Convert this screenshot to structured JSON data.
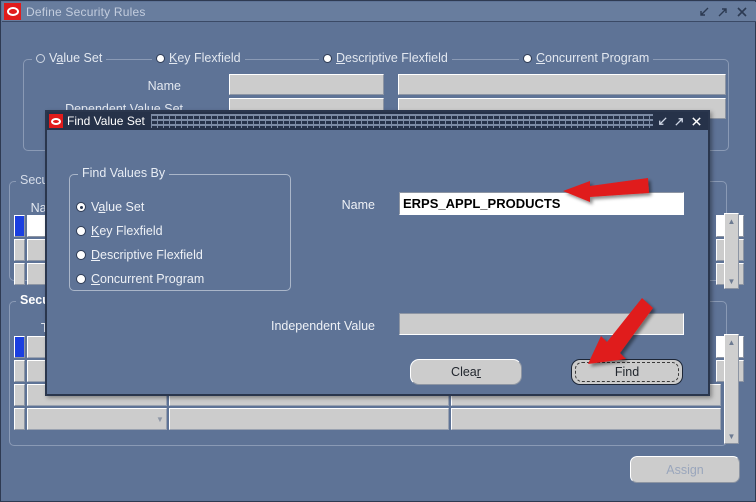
{
  "main_window": {
    "title": "Define Security Rules",
    "logo": "oracle-logo",
    "window_controls": [
      {
        "name": "minimize-icon",
        "glyph": "minimize"
      },
      {
        "name": "maximize-icon",
        "glyph": "maximize"
      },
      {
        "name": "close-icon",
        "glyph": "close"
      }
    ],
    "find_by_radios": [
      {
        "label_pre": "V",
        "mnemonic": "a",
        "label_post": "lue Set",
        "full": "Value Set",
        "state": "unselected"
      },
      {
        "label_pre": "",
        "mnemonic": "K",
        "label_post": "ey Flexfield",
        "full": "Key Flexfield",
        "state": "selected"
      },
      {
        "label_pre": "",
        "mnemonic": "D",
        "label_post": "escriptive Flexfield",
        "full": "Descriptive Flexfield",
        "state": "selected"
      },
      {
        "label_pre": "",
        "mnemonic": "C",
        "label_post": "oncurrent Program",
        "full": "Concurrent Program",
        "state": "selected"
      }
    ],
    "form_labels": {
      "name": "Name",
      "dependent_value_set": "Dependent Value Set"
    },
    "groups": {
      "security_rule": "Secur",
      "security_elements": "Secur"
    },
    "column_headers": {
      "name": "Nam",
      "type": "Typ"
    },
    "assign_button": "Assign"
  },
  "dialog": {
    "title": "Find Value Set",
    "logo": "oracle-logo",
    "window_controls": [
      {
        "name": "minimize-icon",
        "glyph": "minimize"
      },
      {
        "name": "maximize-icon",
        "glyph": "maximize"
      },
      {
        "name": "close-icon",
        "glyph": "close"
      }
    ],
    "group_legend": "Find Values By",
    "radios": [
      {
        "label_pre": "V",
        "mnemonic": "a",
        "label_post": "lue Set",
        "full": "Value Set",
        "state": "checked"
      },
      {
        "label_pre": "",
        "mnemonic": "K",
        "label_post": "ey Flexfield",
        "full": "Key Flexfield",
        "state": "unchecked"
      },
      {
        "label_pre": "",
        "mnemonic": "D",
        "label_post": "escriptive Flexfield",
        "full": "Descriptive Flexfield",
        "state": "unchecked"
      },
      {
        "label_pre": "",
        "mnemonic": "C",
        "label_post": "oncurrent Program",
        "full": "Concurrent Program",
        "state": "unchecked"
      }
    ],
    "name_field": {
      "label": "Name",
      "value": "ERPS_APPL_PRODUCTS",
      "placeholder": ""
    },
    "independent_value_field": {
      "label": "Independent Value",
      "value": "",
      "placeholder": "",
      "enabled": false
    },
    "buttons": {
      "clear_pre": "Clea",
      "clear_mnemonic": "r",
      "clear": "Clear",
      "find_pre": "",
      "find_mnemonic": "F",
      "find_post": "ind",
      "find": "Find"
    }
  },
  "annotations": {
    "arrow_color": "#e01b1b",
    "arrow_name_field": "points-to-name-field",
    "arrow_find_button": "points-to-find-button"
  }
}
